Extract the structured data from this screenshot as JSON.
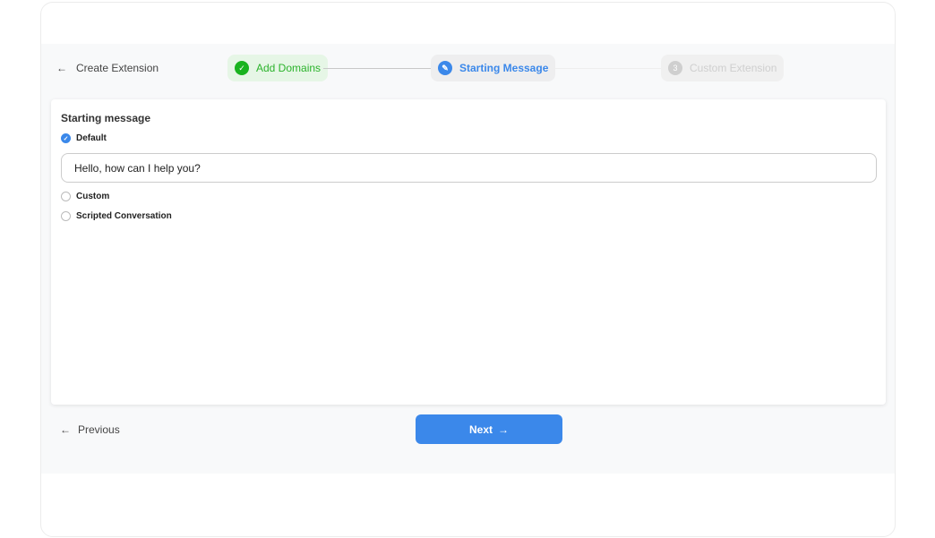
{
  "header": {
    "back_label": "Create Extension"
  },
  "steps": [
    {
      "label": "Add Domains",
      "status": "complete",
      "icon": "✓"
    },
    {
      "label": "Starting Message",
      "status": "active",
      "icon": "✎"
    },
    {
      "label": "Custom Extension",
      "status": "pending",
      "icon": "3"
    }
  ],
  "card": {
    "title": "Starting message",
    "options": [
      {
        "label": "Default",
        "selected": true
      },
      {
        "label": "Custom",
        "selected": false
      },
      {
        "label": "Scripted Conversation",
        "selected": false
      }
    ],
    "default_message": "Hello, how can I help you?"
  },
  "footer": {
    "previous_label": "Previous",
    "next_label": "Next"
  }
}
